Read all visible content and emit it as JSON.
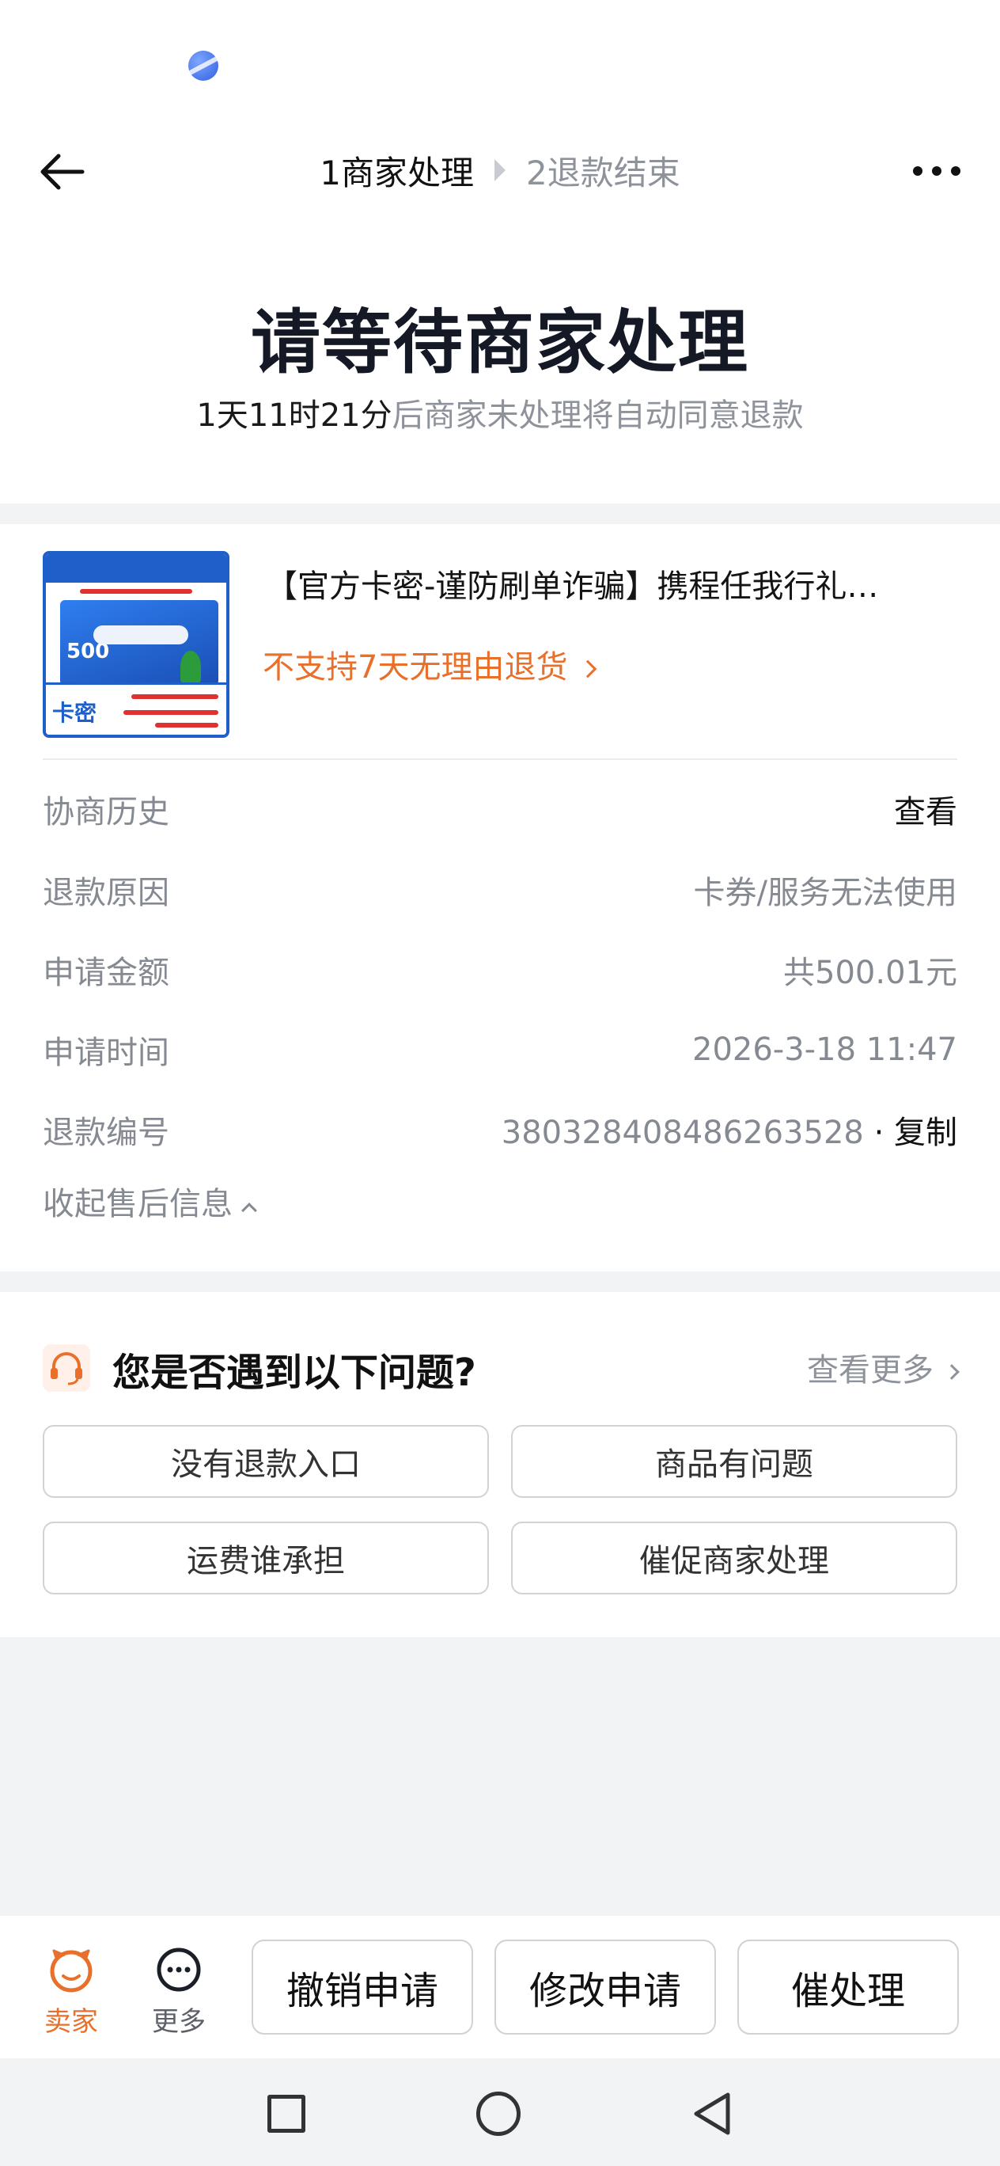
{
  "header": {
    "step1": "1商家处理",
    "step2": "2退款结束"
  },
  "hero": {
    "title": "请等待商家处理",
    "countdown": "1天11时21分",
    "countdown_suffix": "后商家未处理将自动同意退款"
  },
  "product": {
    "title": "【官方卡密-谨防刷单诈骗】携程任我行礼…",
    "return_policy": "不支持7天无理由退货",
    "thumb_amount": "500",
    "thumb_tag": "卡密"
  },
  "details": {
    "history_label": "协商历史",
    "history_action": "查看",
    "reason_label": "退款原因",
    "reason_value": "卡券/服务无法使用",
    "amount_label": "申请金额",
    "amount_value": "共500.01元",
    "time_label": "申请时间",
    "time_value": "2026-3-18 11:47",
    "number_label": "退款编号",
    "number_value": "380328408486263528",
    "copy_label": "· 复制",
    "collapse_label": "收起售后信息"
  },
  "qa": {
    "title": "您是否遇到以下问题?",
    "more": "查看更多",
    "buttons": [
      "没有退款入口",
      "商品有问题",
      "运费谁承担",
      "催促商家处理"
    ]
  },
  "bottom": {
    "seller": "卖家",
    "more": "更多",
    "cancel": "撤销申请",
    "modify": "修改申请",
    "urge": "催处理"
  },
  "colors": {
    "accent": "#e8702a",
    "title": "#141925",
    "muted": "#858a92"
  }
}
